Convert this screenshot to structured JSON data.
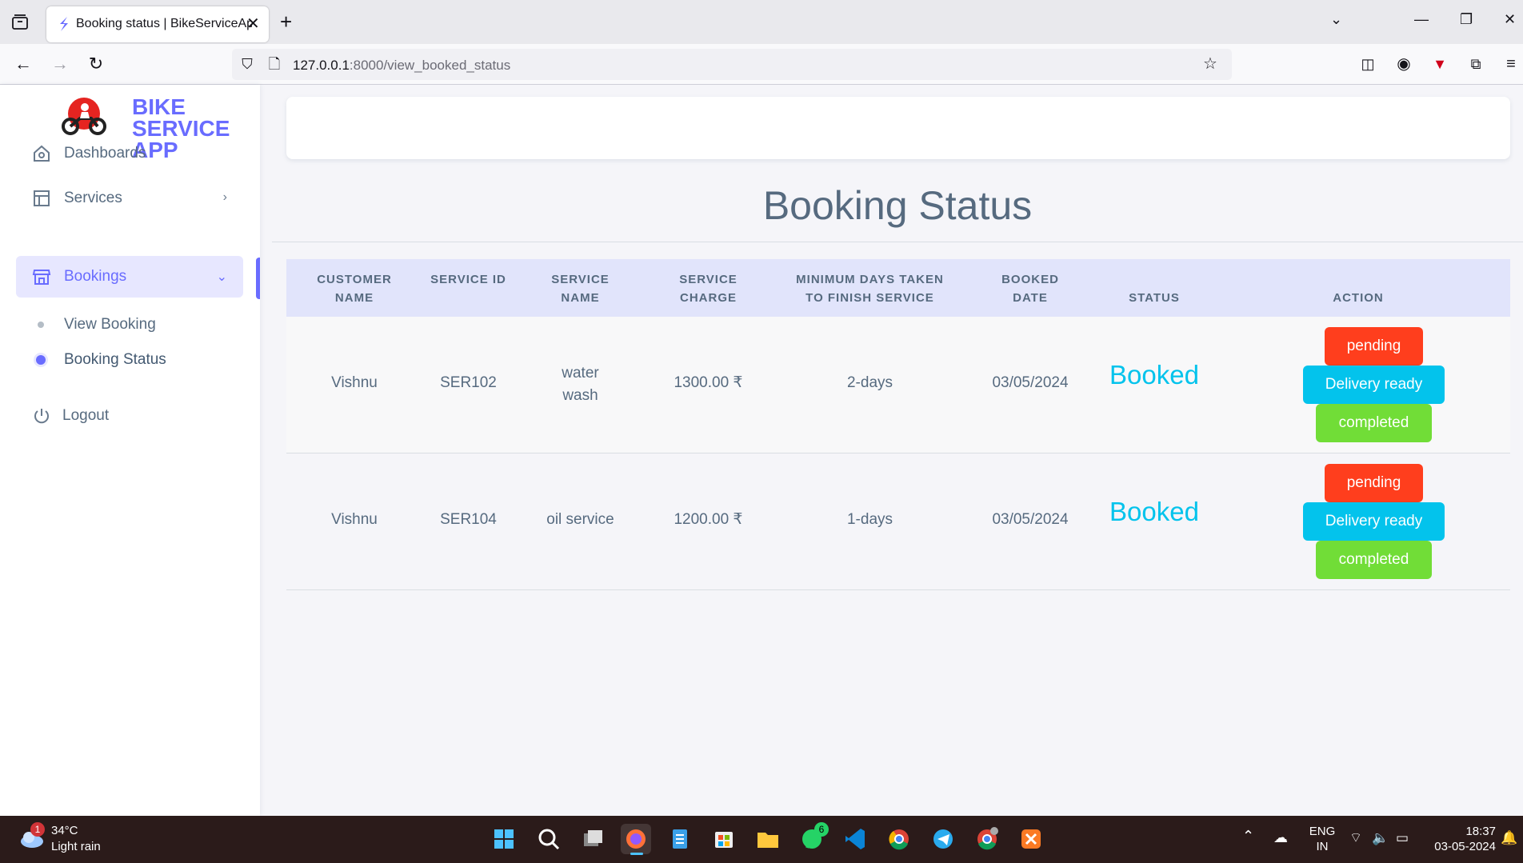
{
  "browser": {
    "tab_title": "Booking status | BikeServiceApp",
    "url_host": "127.0.0.1",
    "url_rest": ":8000/view_booked_status"
  },
  "sidebar": {
    "brand": "BIKE SERVICE APP",
    "items": [
      {
        "label": "Dashboards",
        "icon": "home-icon"
      },
      {
        "label": "Services",
        "icon": "layout-icon"
      },
      {
        "label": "Bookings",
        "icon": "store-icon"
      }
    ],
    "sub_items": [
      {
        "label": "View Booking"
      },
      {
        "label": "Booking Status"
      }
    ],
    "logout": "Logout"
  },
  "page": {
    "title": "Booking Status"
  },
  "table": {
    "headers": {
      "customer_name": "CUSTOMER NAME",
      "service_id": "SERVICE ID",
      "service_name": "SERVICE NAME",
      "service_charge": "SERVICE CHARGE",
      "min_days": "MINIMUM DAYS TAKEN TO FINISH SERVICE",
      "booked_date": "BOOKED DATE",
      "status": "STATUS",
      "action": "ACTION"
    },
    "rows": [
      {
        "customer_name": "Vishnu",
        "service_id": "SER102",
        "service_name": "water wash",
        "service_charge": "1300.00 ₹",
        "min_days": "2-days",
        "booked_date": "03/05/2024",
        "status": "Booked",
        "actions": [
          "pending",
          "Delivery ready",
          "completed"
        ]
      },
      {
        "customer_name": "Vishnu",
        "service_id": "SER104",
        "service_name": "oil service",
        "service_charge": "1200.00 ₹",
        "min_days": "1-days",
        "booked_date": "03/05/2024",
        "status": "Booked",
        "actions": [
          "pending",
          "Delivery ready",
          "completed"
        ]
      }
    ]
  },
  "taskbar": {
    "weather_temp": "34°C",
    "weather_cond": "Light rain",
    "weather_badge": "1",
    "whatsapp_badge": "6",
    "lang_top": "ENG",
    "lang_bottom": "IN",
    "time": "18:37",
    "date": "03-05-2024"
  }
}
